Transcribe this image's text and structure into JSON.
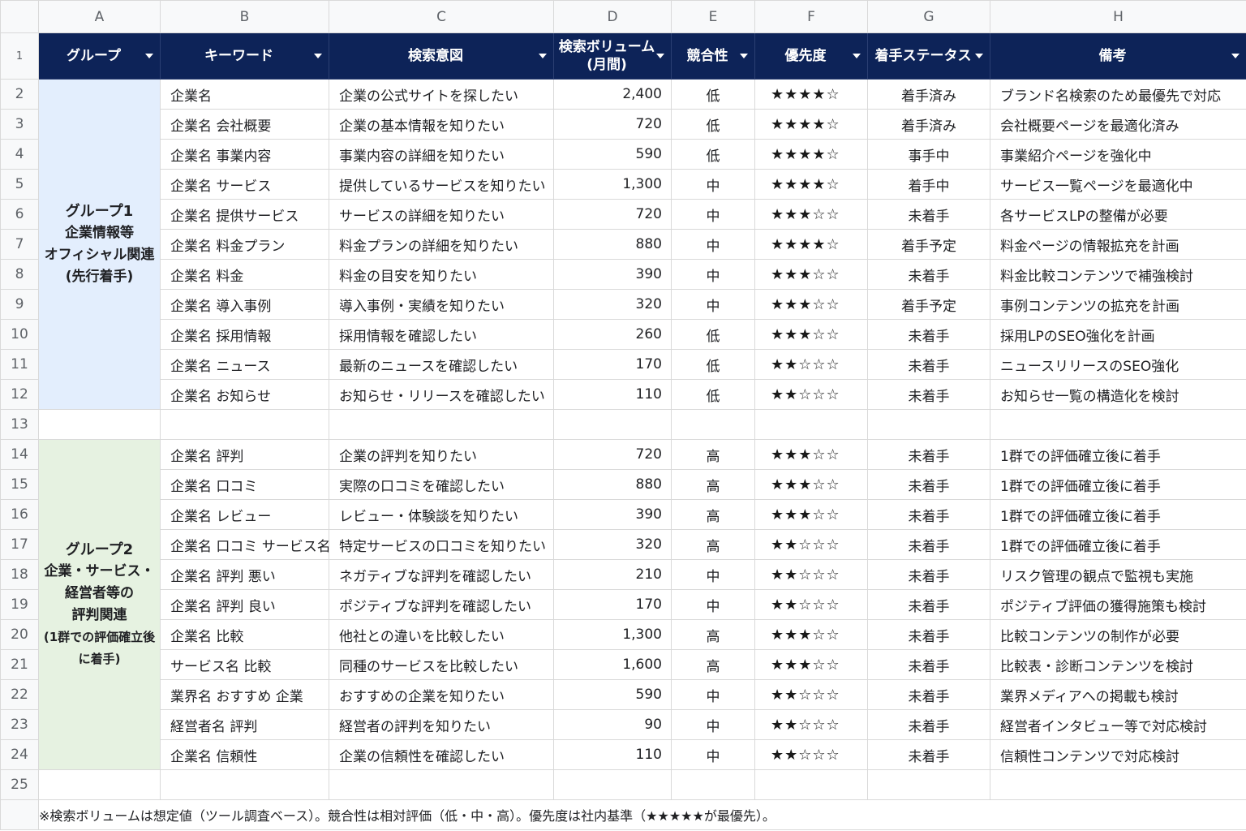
{
  "columns": [
    "A",
    "B",
    "C",
    "D",
    "E",
    "F",
    "G",
    "H"
  ],
  "header": {
    "row_number": "1",
    "group": "グループ",
    "keyword": "キーワード",
    "intent": "検索意図",
    "volume_line1": "検索ボリューム",
    "volume_line2": "(月間)",
    "competition": "競合性",
    "priority": "優先度",
    "status": "着手ステータス",
    "notes": "備考"
  },
  "groups": {
    "g1": {
      "title": "グループ1",
      "line2": "企業情報等",
      "line3": "オフィシャル関連",
      "line4": "(先行着手)"
    },
    "g2": {
      "title": "グループ2",
      "line2": "企業・サービス・",
      "line3": "経営者等の",
      "line4": "評判関連",
      "line5": "(1群での評価確立後",
      "line6": "に着手)"
    }
  },
  "rows": [
    {
      "n": "2",
      "keyword": "企業名",
      "intent": "企業の公式サイトを探したい",
      "volume": "2,400",
      "competition": "低",
      "priority": "★★★★☆",
      "status": "着手済み",
      "note": "ブランド名検索のため最優先で対応"
    },
    {
      "n": "3",
      "keyword": "企業名 会社概要",
      "intent": "企業の基本情報を知りたい",
      "volume": "720",
      "competition": "低",
      "priority": "★★★★☆",
      "status": "着手済み",
      "note": "会社概要ページを最適化済み"
    },
    {
      "n": "4",
      "keyword": "企業名 事業内容",
      "intent": "事業内容の詳細を知りたい",
      "volume": "590",
      "competition": "低",
      "priority": "★★★★☆",
      "status": "事手中",
      "note": "事業紹介ページを強化中"
    },
    {
      "n": "5",
      "keyword": "企業名 サービス",
      "intent": "提供しているサービスを知りたい",
      "volume": "1,300",
      "competition": "中",
      "priority": "★★★★☆",
      "status": "着手中",
      "note": "サービス一覧ページを最適化中"
    },
    {
      "n": "6",
      "keyword": "企業名 提供サービス",
      "intent": "サービスの詳細を知りたい",
      "volume": "720",
      "competition": "中",
      "priority": "★★★☆☆",
      "status": "未着手",
      "note": "各サービスLPの整備が必要"
    },
    {
      "n": "7",
      "keyword": "企業名 料金プラン",
      "intent": "料金プランの詳細を知りたい",
      "volume": "880",
      "competition": "中",
      "priority": "★★★★☆",
      "status": "着手予定",
      "note": "料金ページの情報拡充を計画"
    },
    {
      "n": "8",
      "keyword": "企業名 料金",
      "intent": "料金の目安を知りたい",
      "volume": "390",
      "competition": "中",
      "priority": "★★★☆☆",
      "status": "未着手",
      "note": "料金比較コンテンツで補強検討"
    },
    {
      "n": "9",
      "keyword": "企業名 導入事例",
      "intent": "導入事例・実績を知りたい",
      "volume": "320",
      "competition": "中",
      "priority": "★★★☆☆",
      "status": "着手予定",
      "note": "事例コンテンツの拡充を計画"
    },
    {
      "n": "10",
      "keyword": "企業名 採用情報",
      "intent": "採用情報を確認したい",
      "volume": "260",
      "competition": "低",
      "priority": "★★★☆☆",
      "status": "未着手",
      "note": "採用LPのSEO強化を計画"
    },
    {
      "n": "11",
      "keyword": "企業名 ニュース",
      "intent": "最新のニュースを確認したい",
      "volume": "170",
      "competition": "低",
      "priority": "★★☆☆☆",
      "status": "未着手",
      "note": "ニュースリリースのSEO強化"
    },
    {
      "n": "12",
      "keyword": "企業名 お知らせ",
      "intent": "お知らせ・リリースを確認したい",
      "volume": "110",
      "competition": "低",
      "priority": "★★☆☆☆",
      "status": "未着手",
      "note": "お知らせ一覧の構造化を検討"
    },
    {
      "n": "13",
      "keyword": "",
      "intent": "",
      "volume": "",
      "competition": "",
      "priority": "",
      "status": "",
      "note": ""
    },
    {
      "n": "14",
      "keyword": "企業名 評判",
      "intent": "企業の評判を知りたい",
      "volume": "720",
      "competition": "高",
      "priority": "★★★☆☆",
      "status": "未着手",
      "note": "1群での評価確立後に着手"
    },
    {
      "n": "15",
      "keyword": "企業名 口コミ",
      "intent": "実際の口コミを確認したい",
      "volume": "880",
      "competition": "高",
      "priority": "★★★☆☆",
      "status": "未着手",
      "note": "1群での評価確立後に着手"
    },
    {
      "n": "16",
      "keyword": "企業名 レビュー",
      "intent": "レビュー・体験談を知りたい",
      "volume": "390",
      "competition": "高",
      "priority": "★★★☆☆",
      "status": "未着手",
      "note": "1群での評価確立後に着手"
    },
    {
      "n": "17",
      "keyword": "企業名 口コミ サービス名",
      "intent": "特定サービスの口コミを知りたい",
      "volume": "320",
      "competition": "高",
      "priority": "★★☆☆☆",
      "status": "未着手",
      "note": "1群での評価確立後に着手"
    },
    {
      "n": "18",
      "keyword": "企業名 評判 悪い",
      "intent": "ネガティブな評判を確認したい",
      "volume": "210",
      "competition": "中",
      "priority": "★★☆☆☆",
      "status": "未着手",
      "note": "リスク管理の観点で監視も実施"
    },
    {
      "n": "19",
      "keyword": "企業名 評判 良い",
      "intent": "ポジティブな評判を確認したい",
      "volume": "170",
      "competition": "中",
      "priority": "★★☆☆☆",
      "status": "未着手",
      "note": "ポジティブ評価の獲得施策も検討"
    },
    {
      "n": "20",
      "keyword": "企業名 比較",
      "intent": "他社との違いを比較したい",
      "volume": "1,300",
      "competition": "高",
      "priority": "★★★☆☆",
      "status": "未着手",
      "note": "比較コンテンツの制作が必要"
    },
    {
      "n": "21",
      "keyword": "サービス名 比較",
      "intent": "同種のサービスを比較したい",
      "volume": "1,600",
      "competition": "高",
      "priority": "★★★☆☆",
      "status": "未着手",
      "note": "比較表・診断コンテンツを検討"
    },
    {
      "n": "22",
      "keyword": "業界名 おすすめ 企業",
      "intent": "おすすめの企業を知りたい",
      "volume": "590",
      "competition": "中",
      "priority": "★★☆☆☆",
      "status": "未着手",
      "note": "業界メディアへの掲載も検討"
    },
    {
      "n": "23",
      "keyword": "経営者名 評判",
      "intent": "経営者の評判を知りたい",
      "volume": "90",
      "competition": "中",
      "priority": "★★☆☆☆",
      "status": "未着手",
      "note": "経営者インタビュー等で対応検討"
    },
    {
      "n": "24",
      "keyword": "企業名 信頼性",
      "intent": "企業の信頼性を確認したい",
      "volume": "110",
      "competition": "中",
      "priority": "★★☆☆☆",
      "status": "未着手",
      "note": "信頼性コンテンツで対応検討"
    },
    {
      "n": "25",
      "keyword": "",
      "intent": "",
      "volume": "",
      "competition": "",
      "priority": "",
      "status": "",
      "note": ""
    }
  ],
  "footnote": "※検索ボリュームは想定値（ツール調査ベース）。競合性は相対評価（低・中・高）。優先度は社内基準（★★★★★が最優先）。"
}
